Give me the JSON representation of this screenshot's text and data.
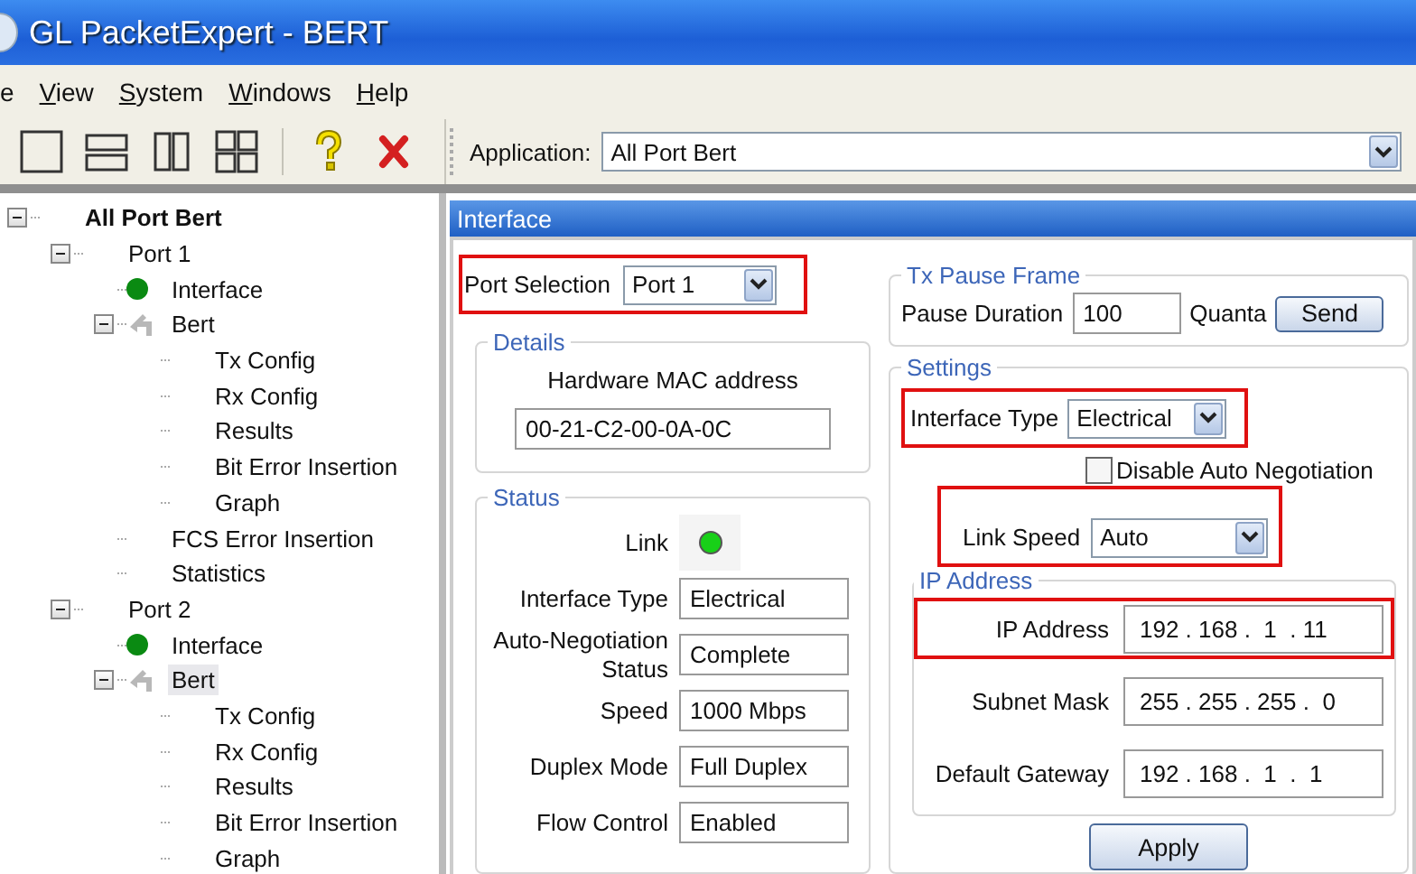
{
  "window": {
    "title": "GL PacketExpert - BERT"
  },
  "menu": [
    {
      "label": "e",
      "mnemonic": false
    },
    {
      "label": "View",
      "mnemonic": true
    },
    {
      "label": "System",
      "mnemonic": true
    },
    {
      "label": "Windows",
      "mnemonic": true
    },
    {
      "label": "Help",
      "mnemonic": true
    }
  ],
  "toolbar": [
    {
      "kind": "single-pane"
    },
    {
      "kind": "two-rows"
    },
    {
      "kind": "two-columns"
    },
    {
      "kind": "grid"
    },
    {
      "kind": "help"
    },
    {
      "kind": "close"
    }
  ],
  "application": {
    "label": "Application:",
    "value": "All Port Bert"
  },
  "tree": [
    {
      "label": "All Port Bert",
      "bold": true,
      "expanded": true,
      "selected": false,
      "children": [
        {
          "label": "Port 1",
          "expanded": true,
          "selected": false,
          "children": [
            {
              "label": "Interface",
              "kind": "dot",
              "selected": false
            },
            {
              "label": "Bert",
              "kind": "arrow",
              "expanded": true,
              "selected": false,
              "children": [
                {
                  "label": "Tx Config",
                  "selected": false
                },
                {
                  "label": "Rx Config",
                  "selected": false
                },
                {
                  "label": "Results",
                  "selected": false
                },
                {
                  "label": "Bit Error Insertion",
                  "selected": false
                },
                {
                  "label": "Graph",
                  "selected": false
                }
              ]
            },
            {
              "label": "FCS Error Insertion",
              "selected": false
            },
            {
              "label": "Statistics",
              "selected": false
            }
          ]
        },
        {
          "label": "Port 2",
          "expanded": true,
          "selected": false,
          "children": [
            {
              "label": "Interface",
              "kind": "dot",
              "selected": false
            },
            {
              "label": "Bert",
              "kind": "arrow",
              "expanded": true,
              "selected": true,
              "children": [
                {
                  "label": "Tx Config",
                  "selected": false
                },
                {
                  "label": "Rx Config",
                  "selected": false
                },
                {
                  "label": "Results",
                  "selected": false
                },
                {
                  "label": "Bit Error Insertion",
                  "selected": false
                },
                {
                  "label": "Graph",
                  "selected": false
                }
              ]
            }
          ]
        }
      ]
    }
  ],
  "panel": {
    "title": "Interface",
    "port_selection": {
      "label": "Port Selection",
      "value": "Port 1",
      "highlighted": true
    },
    "details": {
      "title": "Details",
      "label": "Hardware MAC address",
      "value": "00-21-C2-00-0A-0C"
    },
    "status": {
      "title": "Status",
      "link_label": "Link",
      "link_on": true,
      "rows": [
        {
          "label": "Interface Type",
          "value": "Electrical"
        },
        {
          "label": "Auto-Negotiation Status",
          "value": "Complete"
        },
        {
          "label": "Speed",
          "value": "1000 Mbps"
        },
        {
          "label": "Duplex Mode",
          "value": "Full Duplex"
        },
        {
          "label": "Flow Control",
          "value": "Enabled"
        }
      ]
    },
    "tx_pause": {
      "title": "Tx Pause Frame",
      "label": "Pause Duration",
      "value": "100",
      "unit": "Quanta",
      "button": "Send"
    },
    "settings": {
      "title": "Settings",
      "interface_type": {
        "label": "Interface Type",
        "value": "Electrical",
        "highlighted": true
      },
      "disable_auto_negotiation": {
        "label": "Disable Auto Negotiation",
        "checked": false
      },
      "link_speed": {
        "label": "Link Speed",
        "value": "Auto",
        "highlighted": true
      },
      "ip": {
        "title": "IP Address",
        "rows": [
          {
            "label": "IP Address",
            "value": "192 . 168 .  1  . 11",
            "highlighted": true
          },
          {
            "label": "Subnet Mask",
            "value": "255 . 255 . 255 .  0",
            "highlighted": false
          },
          {
            "label": "Default Gateway",
            "value": "192 . 168 .  1  .  1",
            "highlighted": false
          }
        ]
      },
      "apply": "Apply"
    }
  }
}
